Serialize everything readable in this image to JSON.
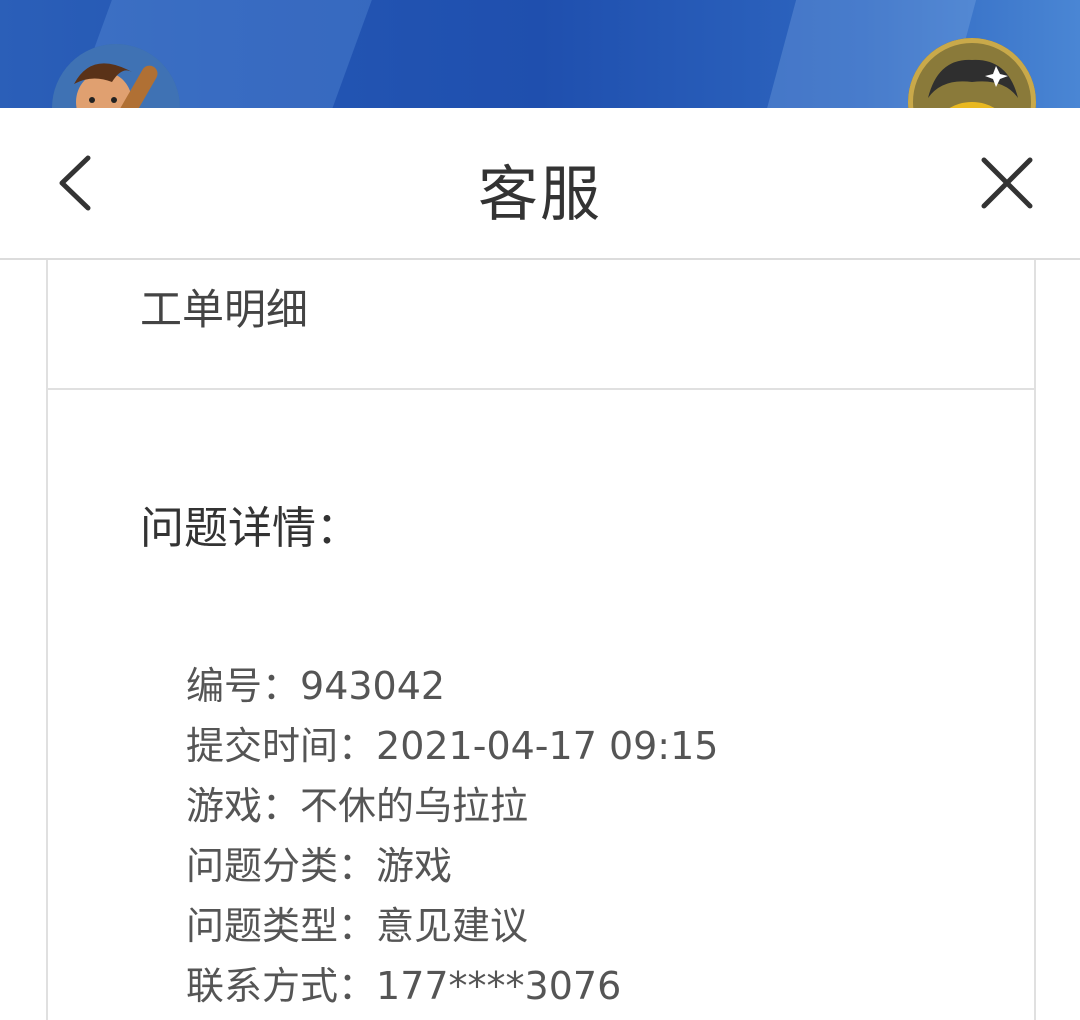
{
  "header": {
    "title": "客服"
  },
  "work_order": {
    "heading": "工单明细",
    "section_title": "问题详情：",
    "fields": [
      {
        "key": "编号",
        "value": "943042"
      },
      {
        "key": "提交时间",
        "value": "2021-04-17 09:15"
      },
      {
        "key": "游戏",
        "value": "不休的乌拉拉"
      },
      {
        "key": "问题分类",
        "value": "游戏"
      },
      {
        "key": "问题类型",
        "value": "意见建议"
      },
      {
        "key": "联系方式",
        "value": "177****3076"
      }
    ]
  },
  "colors": {
    "banner": "#2457b4",
    "text_primary": "#333333",
    "text_secondary": "#555555",
    "divider": "#e0e0e0"
  },
  "icons": {
    "back": "chevron-left-icon",
    "close": "close-icon"
  }
}
